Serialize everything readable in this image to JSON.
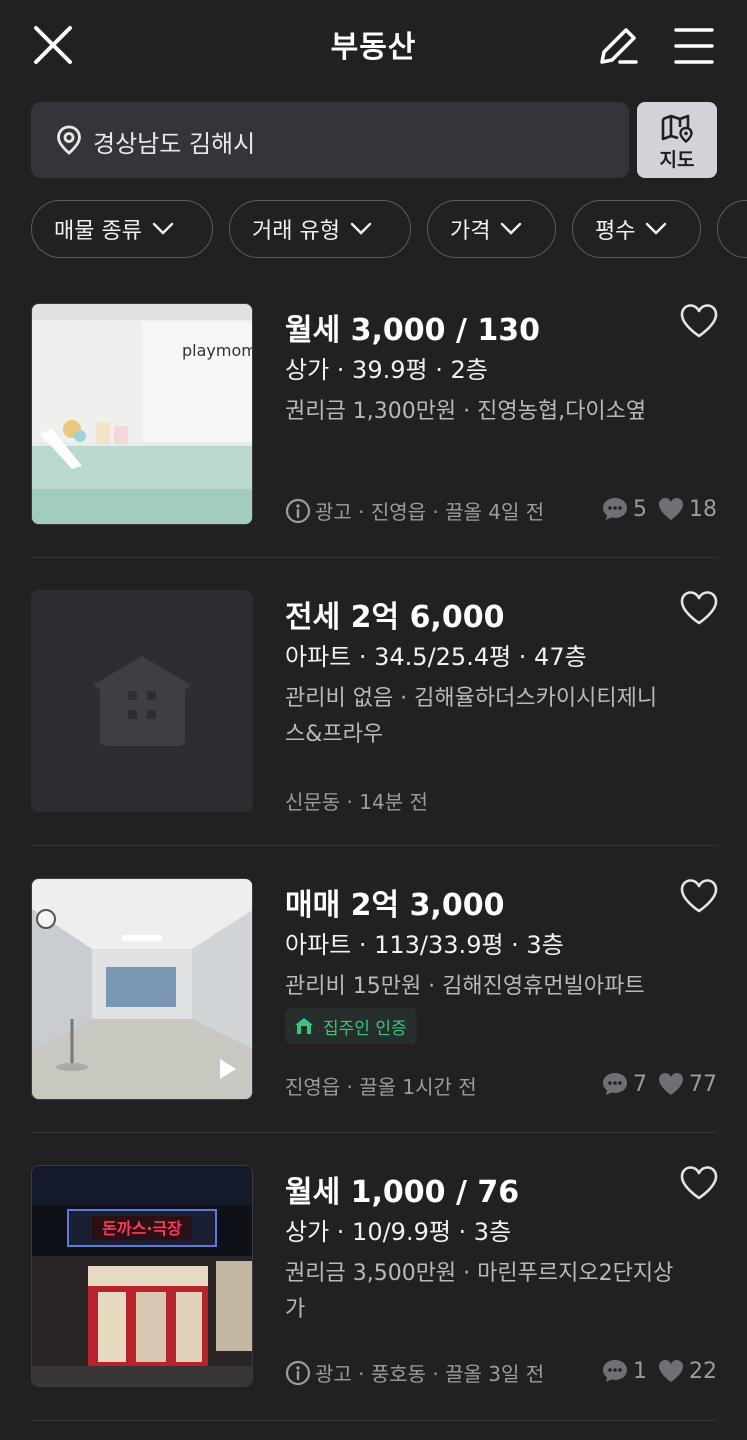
{
  "header": {
    "title": "부동산"
  },
  "search": {
    "location": "경상남도 김해시",
    "map_label": "지도"
  },
  "filters": [
    {
      "label": "매물 종류"
    },
    {
      "label": "거래 유형"
    },
    {
      "label": "가격"
    },
    {
      "label": "평수"
    }
  ],
  "listings": [
    {
      "title": "월세 3,000 / 130",
      "subtitle": "상가 · 39.9평 · 2층",
      "description": "권리금 1,300만원 · 진영농협,다이소옆",
      "meta": "광고 · 진영읍 · 끌올 4일 전",
      "chats": "5",
      "likes": "18",
      "thumb_text": "playmom"
    },
    {
      "title": "전세 2억 6,000",
      "subtitle": "아파트 · 34.5/25.4평 · 47층",
      "description": "관리비 없음 · 김해율하더스카이시티제니스&프라우",
      "meta": "신문동 · 14분 전"
    },
    {
      "title": "매매 2억 3,000",
      "subtitle": "아파트 · 113/33.9평 · 3층",
      "description": "관리비 15만원 · 김해진영휴먼빌아파트",
      "badge": "집주인 인증",
      "meta": "진영읍 · 끌올 1시간 전",
      "chats": "7",
      "likes": "77"
    },
    {
      "title": "월세 1,000 / 76",
      "subtitle": "상가 · 10/9.9평 · 3층",
      "description": "권리금 3,500만원 · 마린푸르지오2단지상가",
      "meta": "광고 · 풍호동 · 끌올 3일 전",
      "chats": "1",
      "likes": "22",
      "thumb_text": "돈까스·극장"
    }
  ],
  "colors": {
    "background": "#212124",
    "chip_border": "#5a5c61",
    "muted_text": "#9a9ca1",
    "verified_green": "#38c67e"
  }
}
